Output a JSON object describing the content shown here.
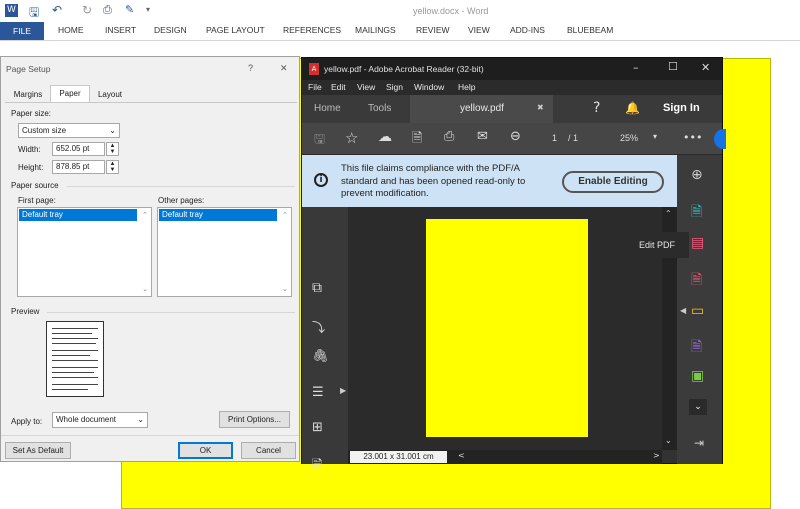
{
  "word": {
    "title": "yellow.docx - Word",
    "file_tab": "FILE",
    "tabs": [
      "HOME",
      "INSERT",
      "DESIGN",
      "PAGE LAYOUT",
      "REFERENCES",
      "MAILINGS",
      "REVIEW",
      "VIEW",
      "ADD-INS",
      "BLUEBEAM"
    ]
  },
  "page_setup": {
    "title": "Page Setup",
    "help": "?",
    "close": "✕",
    "tabs": [
      "Margins",
      "Paper",
      "Layout"
    ],
    "paper_size_label": "Paper size:",
    "paper_size_value": "Custom size",
    "width_label": "Width:",
    "width_value": "652.05 pt",
    "height_label": "Height:",
    "height_value": "878.85 pt",
    "paper_source_label": "Paper source",
    "first_page_label": "First page:",
    "other_pages_label": "Other pages:",
    "first_page_item": "Default tray",
    "other_pages_item": "Default tray",
    "preview_label": "Preview",
    "apply_to_label": "Apply to:",
    "apply_to_value": "Whole document",
    "print_options": "Print Options...",
    "set_default": "Set As Default",
    "ok": "OK",
    "cancel": "Cancel"
  },
  "acrobat": {
    "title": "yellow.pdf - Adobe Acrobat Reader (32-bit)",
    "menu": [
      "File",
      "Edit",
      "View",
      "Sign",
      "Window",
      "Help"
    ],
    "nav_home": "Home",
    "nav_tools": "Tools",
    "doc_tab": "yellow.pdf",
    "sign_in": "Sign In",
    "page_current": "1",
    "page_total": "/ 1",
    "zoom": "25%",
    "banner_text": "This file claims compliance with the PDF/A standard and has been opened read-only to prevent modification.",
    "enable_editing": "Enable Editing",
    "tooltip": "Edit PDF",
    "page_size": "23.001 x 31.001 cm",
    "accent": "#ffff00"
  }
}
